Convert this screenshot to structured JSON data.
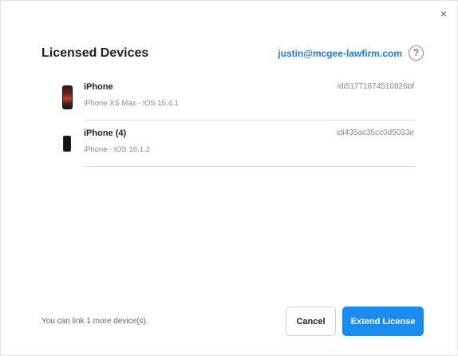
{
  "dialog": {
    "title": "Licensed Devices",
    "close_glyph": "×",
    "account_email": "justin@mcgee-lawfirm.com",
    "help_glyph": "?"
  },
  "devices": [
    {
      "name": "iPhone",
      "model": "iPhone XS Max - iOS 15.4.1",
      "id": "idi51771874510826bf",
      "thumb_icon": "iphone-xs-icon"
    },
    {
      "name": "iPhone (4)",
      "model": "iPhone - iOS 16.1.2",
      "id": "idi435ac35cc0d5033e",
      "thumb_icon": "iphone-icon"
    }
  ],
  "footer": {
    "note": "You can link 1 more device(s).",
    "cancel_label": "Cancel",
    "extend_label": "Extend License"
  },
  "colors": {
    "accent": "#1a8cf0",
    "link": "#1a7fe0"
  }
}
